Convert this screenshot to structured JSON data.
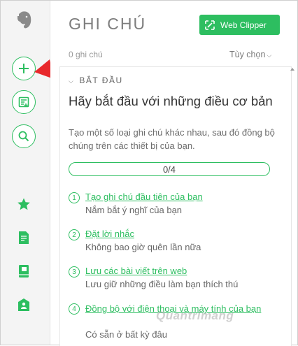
{
  "sidebar": {
    "items": [
      {
        "icon": "elephant-logo-icon"
      },
      {
        "icon": "plus-icon"
      },
      {
        "icon": "new-note-icon"
      },
      {
        "icon": "search-icon"
      },
      {
        "icon": "star-icon"
      },
      {
        "icon": "notes-icon"
      },
      {
        "icon": "notebooks-icon"
      },
      {
        "icon": "shared-icon"
      }
    ]
  },
  "header": {
    "title": "GHI CHÚ",
    "clipper_label": "Web Clipper",
    "note_count": "0 ghi chú",
    "options_label": "Tùy chọn"
  },
  "panel": {
    "section_label": "BẮT ĐẦU",
    "heading": "Hãy bắt đầu với những điều cơ bản",
    "subtitle": "Tạo một số loại ghi chú khác nhau, sau đó đồng bộ chúng trên các thiết bị của bạn.",
    "progress_text": "0/4",
    "progress_value": 0,
    "steps": [
      {
        "num": "1",
        "title": "Tạo ghi chú đầu tiên của bạn",
        "desc": "Nắm bắt ý nghĩ của bạn"
      },
      {
        "num": "2",
        "title": "Đặt lời nhắc",
        "desc": "Không bao giờ quên lần nữa"
      },
      {
        "num": "3",
        "title": "Lưu các bài viết trên web",
        "desc": "Lưu giữ những điều làm bạn thích thú"
      },
      {
        "num": "4",
        "title": "Đồng bộ với điện thoại và máy tính của bạn",
        "desc": "Có sẵn ở bất kỳ đâu"
      }
    ]
  },
  "watermark": "Quantrimang",
  "colors": {
    "accent": "#2dbe60",
    "arrow": "#e8282b",
    "sidebar_bg": "#f4f4f4"
  }
}
